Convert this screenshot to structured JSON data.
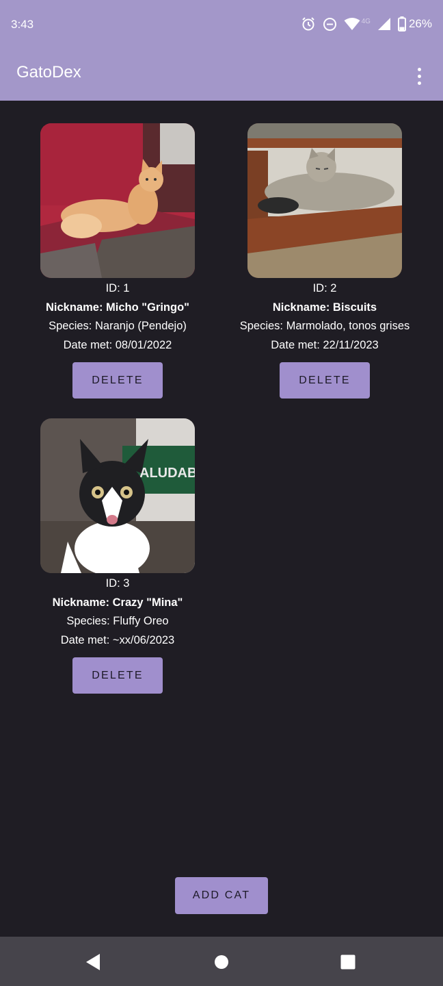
{
  "status_bar": {
    "time": "3:43",
    "network_label": "4G",
    "battery": "26%"
  },
  "app_bar": {
    "title": "GatoDex",
    "overflow_icon": "more-vert-icon"
  },
  "cats": [
    {
      "id_label": "ID: 1",
      "nickname": "Nickname: Micho \"Gringo\"",
      "species": "Species: Naranjo (Pendejo)",
      "date_met": "Date met: 08/01/2022",
      "delete_label": "DELETE"
    },
    {
      "id_label": "ID: 2",
      "nickname": "Nickname: Biscuits",
      "species": "Species: Marmolado, tonos grises",
      "date_met": "Date met: 22/11/2023",
      "delete_label": "DELETE"
    },
    {
      "id_label": "ID: 3",
      "nickname": "Nickname: Crazy \"Mina\"",
      "species": "Species: Fluffy Oreo",
      "date_met": "Date met: ~xx/06/2023",
      "delete_label": "DELETE",
      "photo_text": "ALUDAB"
    }
  ],
  "add_button": "ADD CAT",
  "nav_bar": {
    "back_icon": "back-triangle-icon",
    "home_icon": "home-circle-icon",
    "recents_icon": "recents-square-icon"
  },
  "colors": {
    "accent": "#a397c9",
    "button": "#a08fcd",
    "background": "#1f1d24",
    "nav_bar": "#46444b"
  }
}
